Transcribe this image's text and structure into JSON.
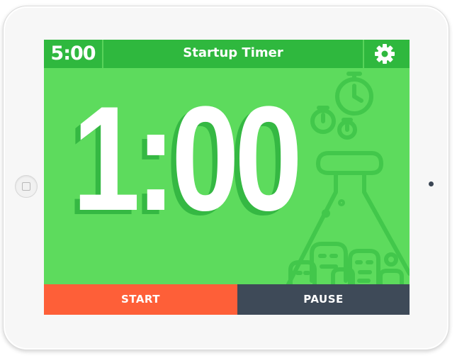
{
  "app": {
    "title": "Startup Timer",
    "clock": "5:00"
  },
  "timer": {
    "display": "1:00"
  },
  "controls": {
    "start_label": "START",
    "pause_label": "PAUSE"
  },
  "icons": {
    "settings": "gear-icon",
    "home": "home-button",
    "camera": "camera-dot"
  },
  "colors": {
    "background": "#5ddb5d",
    "topbar": "#2fb83e",
    "start": "#fe5f38",
    "pause": "#3e4a58",
    "text": "#ffffff"
  }
}
